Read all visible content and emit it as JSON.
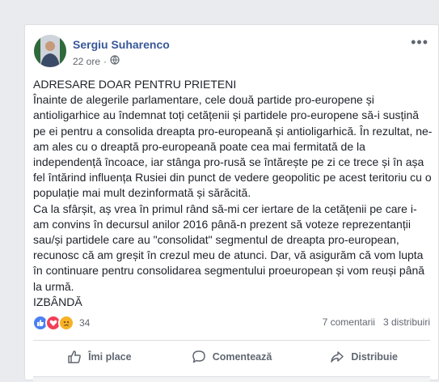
{
  "post": {
    "author": "Sergiu Suharenco",
    "time": "22 ore",
    "privacy_icon": "globe-icon",
    "paragraphs": [
      "ADRESARE DOAR PENTRU PRIETENI",
      "Înainte de alegerile parlamentare, cele două partide pro-europene și antioligarhice au îndemnat toți cetățenii și partidele pro-europene să-i susțină pe ei pentru a consolida dreapta pro-europeană și antioligarhică. În rezultat, ne-am ales cu o dreaptă pro-europeană poate cea mai fermitată de la independență încoace, iar stânga pro-rusă se întărește pe zi ce trece și în așa fel întărind influența Rusiei din punct de vedere geopolitic pe acest teritoriu cu o populație mai mult dezinformată și sărăcită.",
      "Ca la sfârșit, aș vrea în primul rând să-mi cer iertare de la cetățenii pe care i-am convins în decursul anilor 2016 până-n prezent să voteze reprezentanții sau/și partidele care au \"consolidat\" segmentul de dreapta pro-european, recunosc că am greșit în crezul meu de atunci. Dar, vă asigurăm că vom lupta în continuare pentru consolidarea segmentului proeuropean și vom reuși până la urmă.",
      "IZBÂNDĂ"
    ],
    "reaction_count": "34",
    "comments": "7 comentarii",
    "shares": "3 distribuiri"
  },
  "actions": {
    "like": "Îmi place",
    "comment": "Comentează",
    "share": "Distribuie"
  },
  "colors": {
    "link": "#385898",
    "text": "#1d2129",
    "muted": "#616770",
    "background": "#e9ebee"
  }
}
